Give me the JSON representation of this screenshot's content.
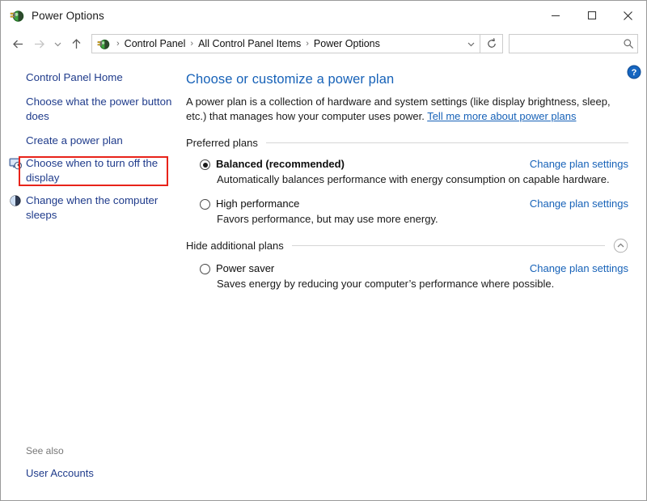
{
  "window": {
    "title": "Power Options",
    "app_icon": "power-plug-icon",
    "minimize_label": "Minimize",
    "maximize_label": "Maximize",
    "close_label": "Close"
  },
  "nav": {
    "back_label": "Back",
    "forward_label": "Forward",
    "recent_label": "Recent locations",
    "up_label": "Up",
    "refresh_label": "Refresh",
    "dropdown_label": "Previous locations",
    "breadcrumbs": [
      "Control Panel",
      "All Control Panel Items",
      "Power Options"
    ],
    "separator": "›"
  },
  "search": {
    "value": "",
    "placeholder": "",
    "icon": "search-icon"
  },
  "sidebar": {
    "items": [
      {
        "label": "Control Panel Home",
        "icon": null,
        "highlighted": false
      },
      {
        "label": "Choose what the power button does",
        "icon": null,
        "highlighted": true
      },
      {
        "label": "Create a power plan",
        "icon": null,
        "highlighted": false
      },
      {
        "label": "Choose when to turn off the display",
        "icon": "monitor-clock-icon",
        "highlighted": false
      },
      {
        "label": "Change when the computer sleeps",
        "icon": "moon-sleep-icon",
        "highlighted": false
      }
    ],
    "see_also": {
      "title": "See also",
      "links": [
        "User Accounts"
      ]
    }
  },
  "main": {
    "title": "Choose or customize a power plan",
    "description_part1": "A power plan is a collection of hardware and system settings (like display brightness, sleep, etc.) that manages how your computer uses power. ",
    "description_link": "Tell me more about power plans",
    "help_icon": "help-question-icon",
    "groups": [
      {
        "label": "Preferred plans",
        "collapsible": false,
        "collapse_icon": null,
        "plans": [
          {
            "name": "Balanced (recommended)",
            "bold": true,
            "selected": true,
            "description": "Automatically balances performance with energy consumption on capable hardware.",
            "link": "Change plan settings"
          },
          {
            "name": "High performance",
            "bold": false,
            "selected": false,
            "description": "Favors performance, but may use more energy.",
            "link": "Change plan settings"
          }
        ]
      },
      {
        "label": "Hide additional plans",
        "collapsible": true,
        "collapse_icon": "chevron-up-circle-icon",
        "plans": [
          {
            "name": "Power saver",
            "bold": false,
            "selected": false,
            "description": "Saves energy by reducing your computer’s performance where possible.",
            "link": "Change plan settings"
          }
        ]
      }
    ]
  },
  "colors": {
    "link_blue": "#1762b8",
    "sidebar_link": "#1f3b8b",
    "highlight_red": "#e8231a",
    "title_blue": "#1762b8",
    "text": "#1a1a1a"
  }
}
